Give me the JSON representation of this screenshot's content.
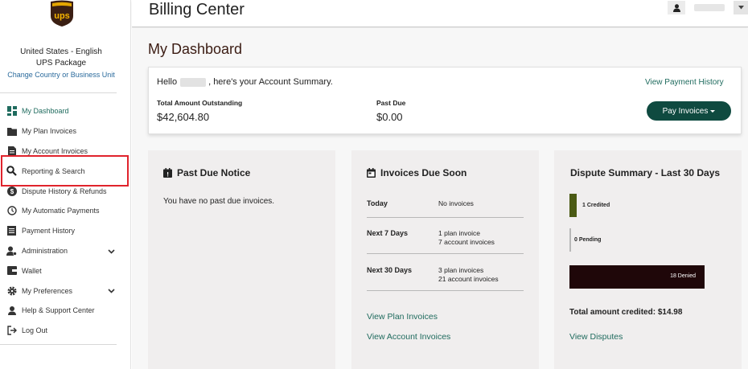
{
  "brand": {
    "logo_text": "ups",
    "colors": {
      "accent": "#1f6b5e",
      "button": "#0f4a40",
      "logo_brown": "#3b1f13",
      "logo_gold": "#f7b500",
      "highlight": "#e0232c"
    }
  },
  "sidebar": {
    "locale_line1": "United States - English",
    "locale_line2": "UPS Package",
    "change_link": "Change Country or Business Unit",
    "items": [
      {
        "label": "My Dashboard",
        "icon": "dashboard-icon"
      },
      {
        "label": "My Plan Invoices",
        "icon": "folder-icon"
      },
      {
        "label": "My Account Invoices",
        "icon": "document-icon"
      },
      {
        "label": "Reporting & Search",
        "icon": "search-icon"
      },
      {
        "label": "Dispute History & Refunds",
        "icon": "dollar-circle-icon"
      },
      {
        "label": "My Automatic Payments",
        "icon": "clock-icon"
      },
      {
        "label": "Payment History",
        "icon": "list-icon"
      },
      {
        "label": "Administration",
        "icon": "user-gear-icon"
      },
      {
        "label": "Wallet",
        "icon": "wallet-icon"
      },
      {
        "label": "My Preferences",
        "icon": "gear-icon"
      },
      {
        "label": "Help & Support Center",
        "icon": "support-icon"
      },
      {
        "label": "Log Out",
        "icon": "logout-icon"
      }
    ]
  },
  "header": {
    "title": "Billing Center",
    "user_icon": "user-icon",
    "dropdown_icon": "caret-down-icon"
  },
  "main": {
    "page_title": "My Dashboard",
    "summary": {
      "greeting_prefix": "Hello",
      "greeting_suffix": ", here's your Account Summary.",
      "view_payment_history": "View Payment History",
      "total_label": "Total Amount Outstanding",
      "total_value": "$42,604.80",
      "past_due_label": "Past Due",
      "past_due_value": "$0.00",
      "pay_button": "Pay Invoices"
    },
    "past_due_card": {
      "title": "Past Due Notice",
      "icon": "calendar-alert-icon",
      "message": "You have no past due invoices."
    },
    "invoices_due_card": {
      "title": "Invoices Due Soon",
      "icon": "calendar-icon",
      "rows": [
        {
          "when": "Today",
          "line1": "No invoices",
          "line2": ""
        },
        {
          "when": "Next 7 Days",
          "line1": "1 plan invoice",
          "line2": "7 account invoices"
        },
        {
          "when": "Next 30 Days",
          "line1": "3 plan invoices",
          "line2": "21 account invoices"
        }
      ],
      "link_plan": "View Plan Invoices",
      "link_account": "View Account Invoices"
    },
    "dispute_card": {
      "title": "Dispute Summary - Last 30 Days",
      "credited_label": "1 Credited",
      "pending_label": "0 Pending",
      "denied_label": "18 Denied",
      "credited_count": 1,
      "pending_count": 0,
      "denied_count": 18,
      "total_label": "Total amount credited:",
      "total_value": "$14.98",
      "link": "View Disputes",
      "colors": {
        "credited": "#4b5a14",
        "pending": "#b8b8b8",
        "denied": "#1f0709"
      }
    }
  }
}
